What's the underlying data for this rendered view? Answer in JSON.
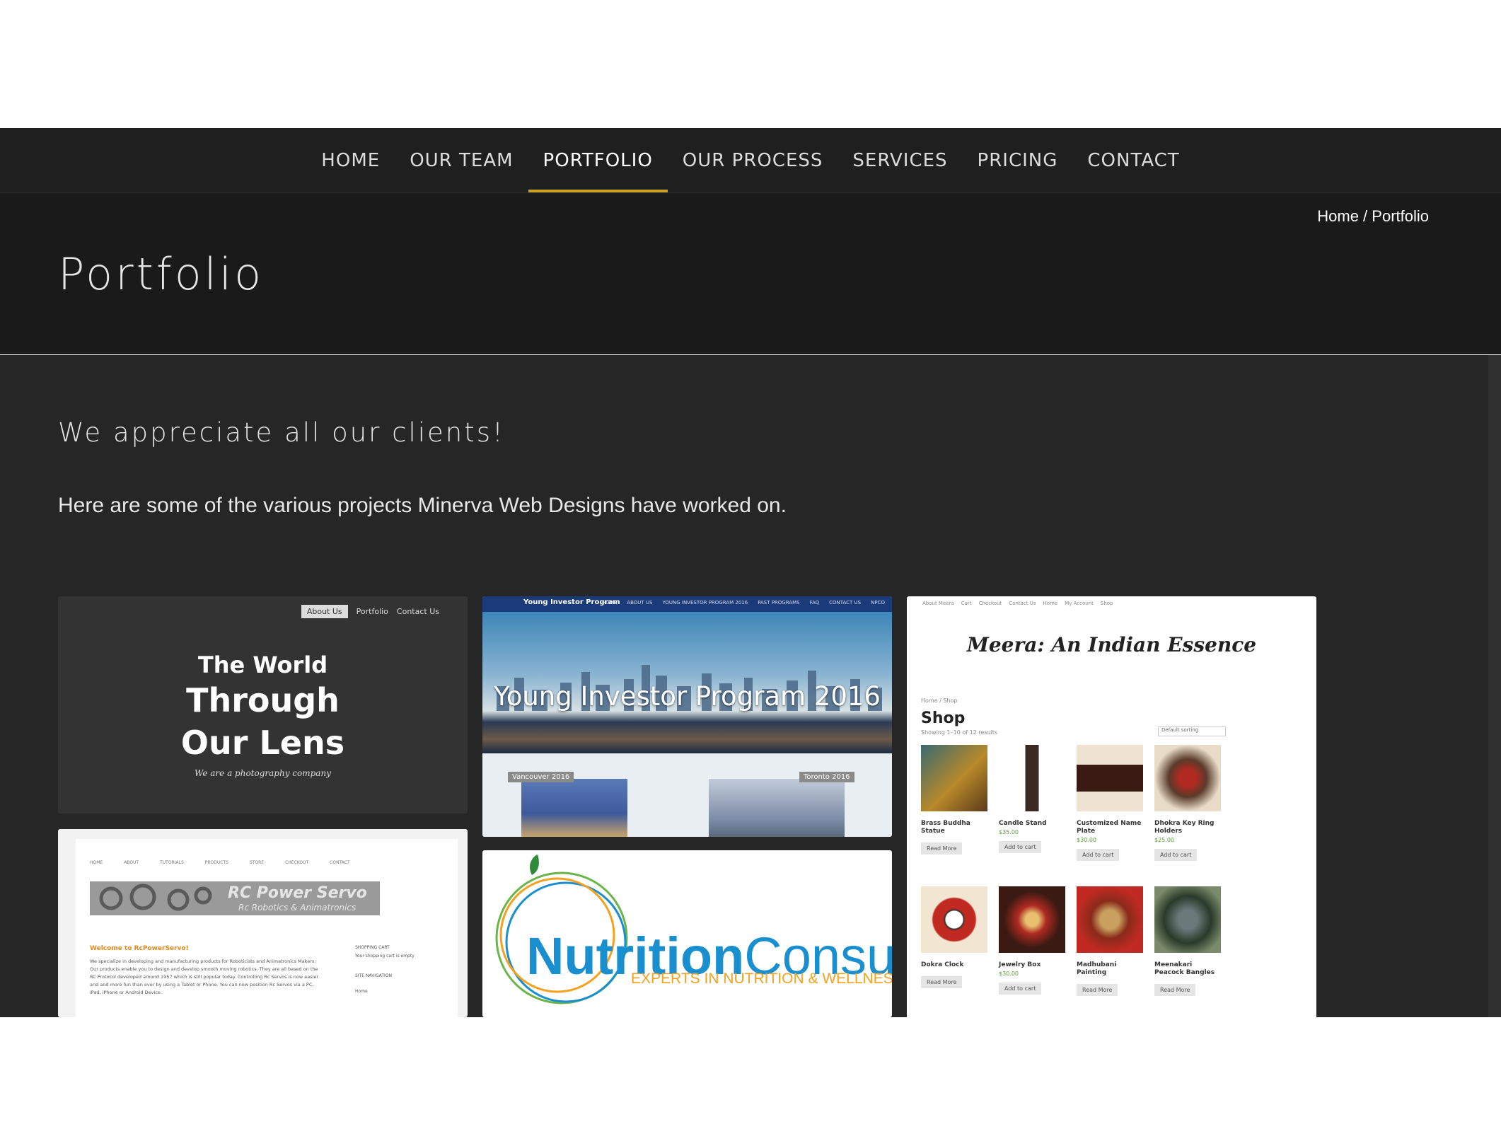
{
  "nav": {
    "items": [
      {
        "label": "HOME",
        "active": false
      },
      {
        "label": "OUR TEAM",
        "active": false
      },
      {
        "label": "PORTFOLIO",
        "active": true
      },
      {
        "label": "OUR PROCESS",
        "active": false
      },
      {
        "label": "SERVICES",
        "active": false
      },
      {
        "label": "PRICING",
        "active": false
      },
      {
        "label": "CONTACT",
        "active": false
      }
    ],
    "accent_color": "#c9a227"
  },
  "breadcrumb": {
    "home": "Home",
    "separator": " / ",
    "current": "Portfolio"
  },
  "page": {
    "title": "Portfolio",
    "subtitle": "We appreciate all our clients!",
    "intro": "Here are some of the various projects Minerva Web Designs have worked on."
  },
  "portfolio": {
    "photography": {
      "nav": [
        "About Us",
        "Portfolio",
        "Contact Us"
      ],
      "line1": "The World",
      "line2": "Through",
      "line3": "Our Lens",
      "tagline": "We are a photography company"
    },
    "investor": {
      "brand": "Young Investor Program",
      "nav": [
        "HOME",
        "ABOUT US",
        "YOUNG INVESTOR PROGRAM 2016",
        "PAST PROGRAMS",
        "FAQ",
        "CONTACT US",
        "NPCO"
      ],
      "title": "Young Investor Program 2016",
      "caption1": "Vancouver 2016",
      "caption2": "Toronto 2016"
    },
    "meera": {
      "nav": [
        "About Meera",
        "Cart",
        "Checkout",
        "Contact Us",
        "Home",
        "My Account",
        "Shop"
      ],
      "brand": "Meera: An Indian Essence",
      "crumb": "Home / Shop",
      "heading": "Shop",
      "showing": "Showing 1–10 of 12 results",
      "sort": "Default sorting",
      "products": [
        {
          "name": "Brass Buddha Statue",
          "price": "",
          "button": "Read More"
        },
        {
          "name": "Candle Stand",
          "price": "$35.00",
          "button": "Add to cart"
        },
        {
          "name": "Customized Name Plate",
          "price": "$30.00",
          "button": "Add to cart"
        },
        {
          "name": "Dhokra Key Ring Holders",
          "price": "$25.00",
          "button": "Add to cart"
        },
        {
          "name": "Dokra Clock",
          "price": "",
          "button": "Read More"
        },
        {
          "name": "Jewelry Box",
          "price": "$30.00",
          "button": "Add to cart"
        },
        {
          "name": "Madhubani Painting",
          "price": "",
          "button": "Read More"
        },
        {
          "name": "Meenakari Peacock Bangles",
          "price": "",
          "button": "Read More"
        }
      ]
    },
    "rcpower": {
      "nav": [
        "HOME",
        "ABOUT",
        "TUTORIALS",
        "PRODUCTS",
        "STORE",
        "CHECKOUT",
        "CONTACT"
      ],
      "banner_title": "RC Power Servo",
      "banner_sub": "Rc Robotics & Animatronics",
      "welcome": "Welcome to RcPowerServo!",
      "body": "We specialize in developing and manufacturing products for Roboticists and Animatronics Makers. Our products enable you to design and develop smooth moving robotics. They are all based on the RC Protocol developed around 1957 which is still popular today. Controlling Rc Servos is now easier and and more fun than ever by using a Tablet or Phone. You can now position Rc Servos via a PC, iPad, iPhone or Android Device.",
      "side_cart": "SHOPPING CART",
      "side_cart_text": "Your shopping cart is empty",
      "side_nav": "SITE NAVIGATION",
      "side_link": "Home"
    },
    "nutrition": {
      "title_a": "Nutrition",
      "title_b": "Consult",
      "tagline": "EXPERTS IN NUTRITION & WELLNESS"
    }
  }
}
